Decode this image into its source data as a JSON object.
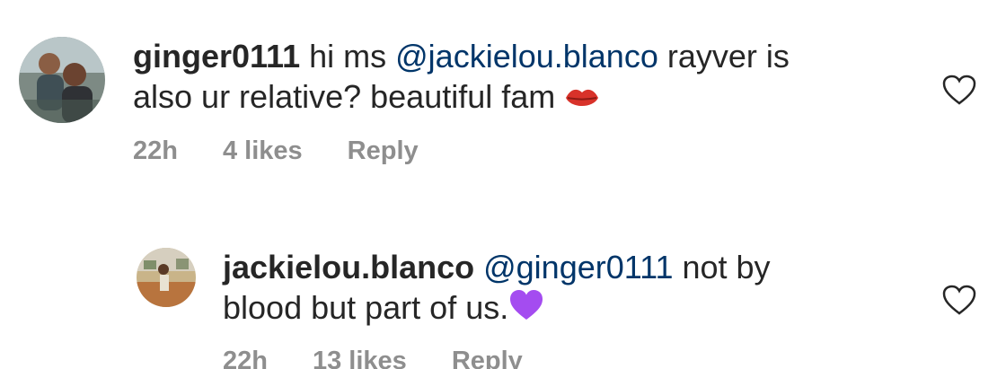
{
  "comments": [
    {
      "username": "ginger0111",
      "text_before_mention": " hi ms ",
      "mention": "@jackielou.blanco",
      "text_after_mention": " rayver is",
      "line2": "also ur relative? beautiful fam ",
      "emoji": "kiss-lips-icon",
      "time": "22h",
      "likes": "4 likes",
      "reply_label": "Reply"
    },
    {
      "username": "jackielou.blanco",
      "text_before_mention": " ",
      "mention": "@ginger0111",
      "text_after_mention": " not by",
      "line2": "blood but part of us.",
      "emoji": "purple-heart-icon",
      "time": "22h",
      "likes": "13 likes",
      "reply_label": "Reply"
    }
  ],
  "colors": {
    "text": "#262626",
    "mention": "#003569",
    "meta": "#8e8e8e",
    "purple_heart": "#a44cf0",
    "lips": "#d8322a"
  }
}
